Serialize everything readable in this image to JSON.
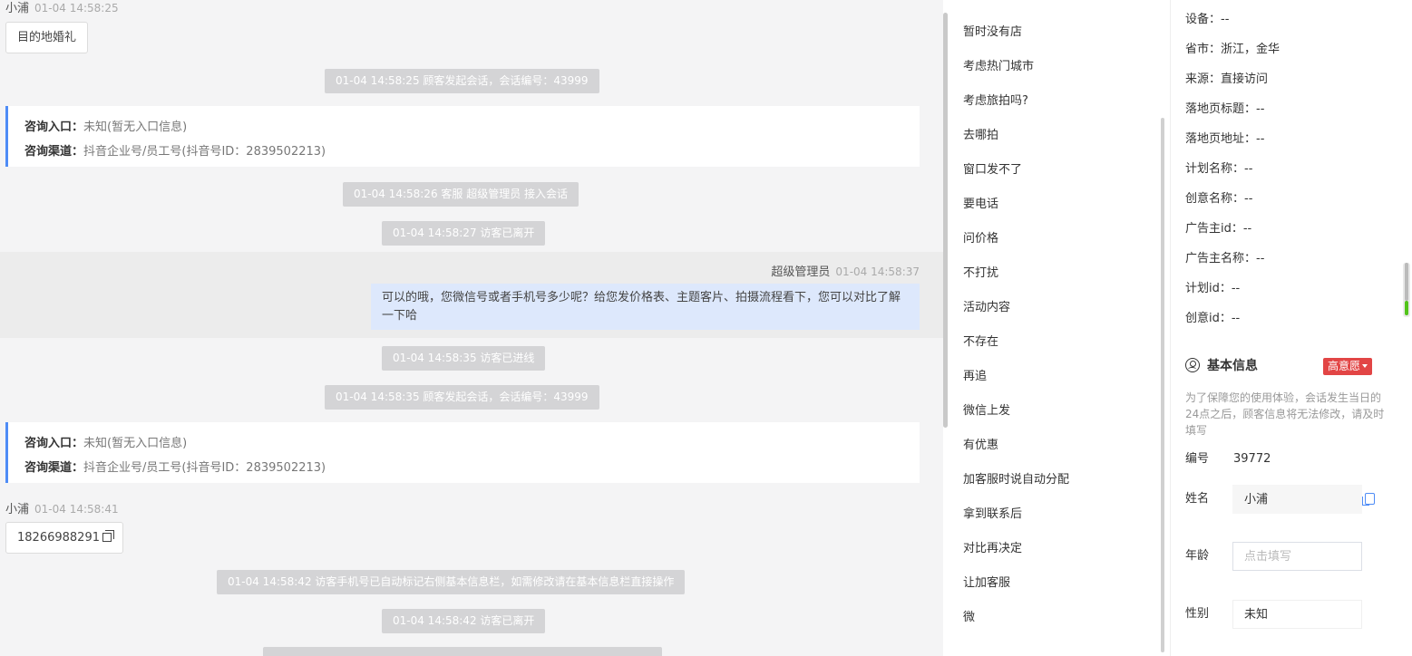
{
  "chat": {
    "visitor_name_1": "小浦",
    "visitor_time_1": "01-04 14:58:25",
    "visitor_msg_1": "目的地婚礼",
    "sys_1": "01-04 14:58:25 顾客发起会话，会话编号：43999",
    "card_1": {
      "entry_label": "咨询入口：",
      "entry_value": "未知(暂无入口信息)",
      "channel_label": "咨询渠道：",
      "channel_value": "抖音企业号/员工号(抖音号ID：2839502213)"
    },
    "sys_2": "01-04 14:58:26 客服 超级管理员 接入会话",
    "sys_3": "01-04 14:58:27 访客已离开",
    "agent_name": "超级管理员",
    "agent_time": "01-04 14:58:37",
    "agent_msg": "可以的哦，您微信号或者手机号多少呢？给您发价格表、主题客片、拍摄流程看下，您可以对比了解一下哈",
    "sys_4": "01-04 14:58:35 访客已进线",
    "sys_5": "01-04 14:58:35 顾客发起会话，会话编号：43999",
    "card_2": {
      "entry_label": "咨询入口：",
      "entry_value": "未知(暂无入口信息)",
      "channel_label": "咨询渠道：",
      "channel_value": "抖音企业号/员工号(抖音号ID：2839502213)"
    },
    "visitor_name_2": "小浦",
    "visitor_time_2": "01-04 14:58:41",
    "visitor_msg_2": "18266988291",
    "sys_6": "01-04 14:58:42 访客手机号已自动标记右侧基本信息栏，如需修改请在基本信息栏直接操作",
    "sys_7": "01-04 14:58:42 访客已离开"
  },
  "quick_replies": [
    "暂时没有店",
    "考虑热门城市",
    "考虑旅拍吗?",
    "去哪拍",
    "窗口发不了",
    "要电话",
    "问价格",
    "不打扰",
    "活动内容",
    "不存在",
    "再追",
    "微信上发",
    "有优惠",
    "加客服时说自动分配",
    "拿到联系后",
    "对比再决定",
    "让加客服",
    "微"
  ],
  "info": {
    "rows": [
      "设备：--",
      "省市：浙江，金华",
      "来源：直接访问",
      "落地页标题：--",
      "落地页地址：--",
      "计划名称：--",
      "创意名称：--",
      "广告主id：--",
      "广告主名称：--",
      "计划id：--",
      "创意id：--"
    ],
    "section_title": "基本信息",
    "intent_badge": "高意愿",
    "note": "为了保障您的使用体验，会话发生当日的24点之后，顾客信息将无法修改，请及时填写",
    "id_label": "编号",
    "id_value": "39772",
    "name_label": "姓名",
    "name_value": "小浦",
    "age_label": "年龄",
    "age_placeholder": "点击填写",
    "gender_label": "性别",
    "gender_value": "未知"
  }
}
